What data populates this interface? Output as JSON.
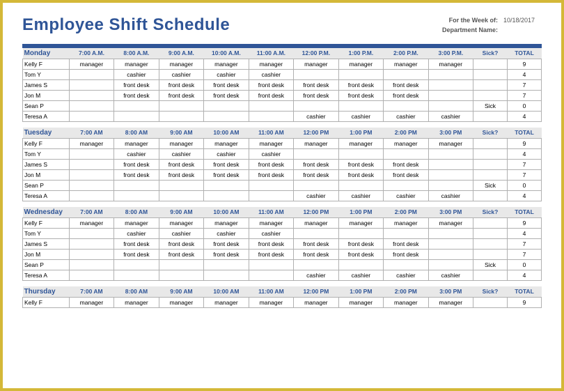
{
  "title": "Employee Shift Schedule",
  "meta": {
    "week_label": "For the Week of:",
    "week_value": "10/18/2017",
    "dept_label": "Department Name:",
    "dept_value": ""
  },
  "columns": {
    "sick": "Sick?",
    "total": "TOTAL"
  },
  "days": [
    {
      "name": "Monday",
      "times": [
        "7:00 A.M.",
        "8:00 A.M.",
        "9:00 A.M.",
        "10:00 A.M.",
        "11:00 A.M.",
        "12:00 P.M.",
        "1:00 P.M.",
        "2:00 P.M.",
        "3:00 P.M."
      ],
      "rows": [
        {
          "name": "Kelly F",
          "cells": [
            "manager",
            "manager",
            "manager",
            "manager",
            "manager",
            "manager",
            "manager",
            "manager",
            "manager"
          ],
          "sick": "",
          "total": "9"
        },
        {
          "name": "Tom Y",
          "cells": [
            "",
            "cashier",
            "cashier",
            "cashier",
            "cashier",
            "",
            "",
            "",
            ""
          ],
          "sick": "",
          "total": "4"
        },
        {
          "name": "James S",
          "cells": [
            "",
            "front desk",
            "front desk",
            "front desk",
            "front desk",
            "front desk",
            "front desk",
            "front desk",
            ""
          ],
          "sick": "",
          "total": "7"
        },
        {
          "name": "Jon M",
          "cells": [
            "",
            "front desk",
            "front desk",
            "front desk",
            "front desk",
            "front desk",
            "front desk",
            "front desk",
            ""
          ],
          "sick": "",
          "total": "7"
        },
        {
          "name": "Sean P",
          "cells": [
            "",
            "",
            "",
            "",
            "",
            "",
            "",
            "",
            ""
          ],
          "sick": "Sick",
          "total": "0"
        },
        {
          "name": "Teresa A",
          "cells": [
            "",
            "",
            "",
            "",
            "",
            "cashier",
            "cashier",
            "cashier",
            "cashier"
          ],
          "sick": "",
          "total": "4"
        }
      ]
    },
    {
      "name": "Tuesday",
      "times": [
        "7:00 AM",
        "8:00 AM",
        "9:00 AM",
        "10:00 AM",
        "11:00 AM",
        "12:00 PM",
        "1:00 PM",
        "2:00 PM",
        "3:00 PM"
      ],
      "rows": [
        {
          "name": "Kelly F",
          "cells": [
            "manager",
            "manager",
            "manager",
            "manager",
            "manager",
            "manager",
            "manager",
            "manager",
            "manager"
          ],
          "sick": "",
          "total": "9"
        },
        {
          "name": "Tom Y",
          "cells": [
            "",
            "cashier",
            "cashier",
            "cashier",
            "cashier",
            "",
            "",
            "",
            ""
          ],
          "sick": "",
          "total": "4"
        },
        {
          "name": "James S",
          "cells": [
            "",
            "front desk",
            "front desk",
            "front desk",
            "front desk",
            "front desk",
            "front desk",
            "front desk",
            ""
          ],
          "sick": "",
          "total": "7"
        },
        {
          "name": "Jon M",
          "cells": [
            "",
            "front desk",
            "front desk",
            "front desk",
            "front desk",
            "front desk",
            "front desk",
            "front desk",
            ""
          ],
          "sick": "",
          "total": "7"
        },
        {
          "name": "Sean P",
          "cells": [
            "",
            "",
            "",
            "",
            "",
            "",
            "",
            "",
            ""
          ],
          "sick": "Sick",
          "total": "0"
        },
        {
          "name": "Teresa A",
          "cells": [
            "",
            "",
            "",
            "",
            "",
            "cashier",
            "cashier",
            "cashier",
            "cashier"
          ],
          "sick": "",
          "total": "4"
        }
      ]
    },
    {
      "name": "Wednesday",
      "times": [
        "7:00 AM",
        "8:00 AM",
        "9:00 AM",
        "10:00 AM",
        "11:00 AM",
        "12:00 PM",
        "1:00 PM",
        "2:00 PM",
        "3:00 PM"
      ],
      "rows": [
        {
          "name": "Kelly F",
          "cells": [
            "manager",
            "manager",
            "manager",
            "manager",
            "manager",
            "manager",
            "manager",
            "manager",
            "manager"
          ],
          "sick": "",
          "total": "9"
        },
        {
          "name": "Tom Y",
          "cells": [
            "",
            "cashier",
            "cashier",
            "cashier",
            "cashier",
            "",
            "",
            "",
            ""
          ],
          "sick": "",
          "total": "4"
        },
        {
          "name": "James S",
          "cells": [
            "",
            "front desk",
            "front desk",
            "front desk",
            "front desk",
            "front desk",
            "front desk",
            "front desk",
            ""
          ],
          "sick": "",
          "total": "7"
        },
        {
          "name": "Jon M",
          "cells": [
            "",
            "front desk",
            "front desk",
            "front desk",
            "front desk",
            "front desk",
            "front desk",
            "front desk",
            ""
          ],
          "sick": "",
          "total": "7"
        },
        {
          "name": "Sean P",
          "cells": [
            "",
            "",
            "",
            "",
            "",
            "",
            "",
            "",
            ""
          ],
          "sick": "Sick",
          "total": "0"
        },
        {
          "name": "Teresa A",
          "cells": [
            "",
            "",
            "",
            "",
            "",
            "cashier",
            "cashier",
            "cashier",
            "cashier"
          ],
          "sick": "",
          "total": "4"
        }
      ]
    },
    {
      "name": "Thursday",
      "times": [
        "7:00 AM",
        "8:00 AM",
        "9:00 AM",
        "10:00 AM",
        "11:00 AM",
        "12:00 PM",
        "1:00 PM",
        "2:00 PM",
        "3:00 PM"
      ],
      "rows": [
        {
          "name": "Kelly F",
          "cells": [
            "manager",
            "manager",
            "manager",
            "manager",
            "manager",
            "manager",
            "manager",
            "manager",
            "manager"
          ],
          "sick": "",
          "total": "9"
        }
      ]
    }
  ],
  "watermark": ""
}
